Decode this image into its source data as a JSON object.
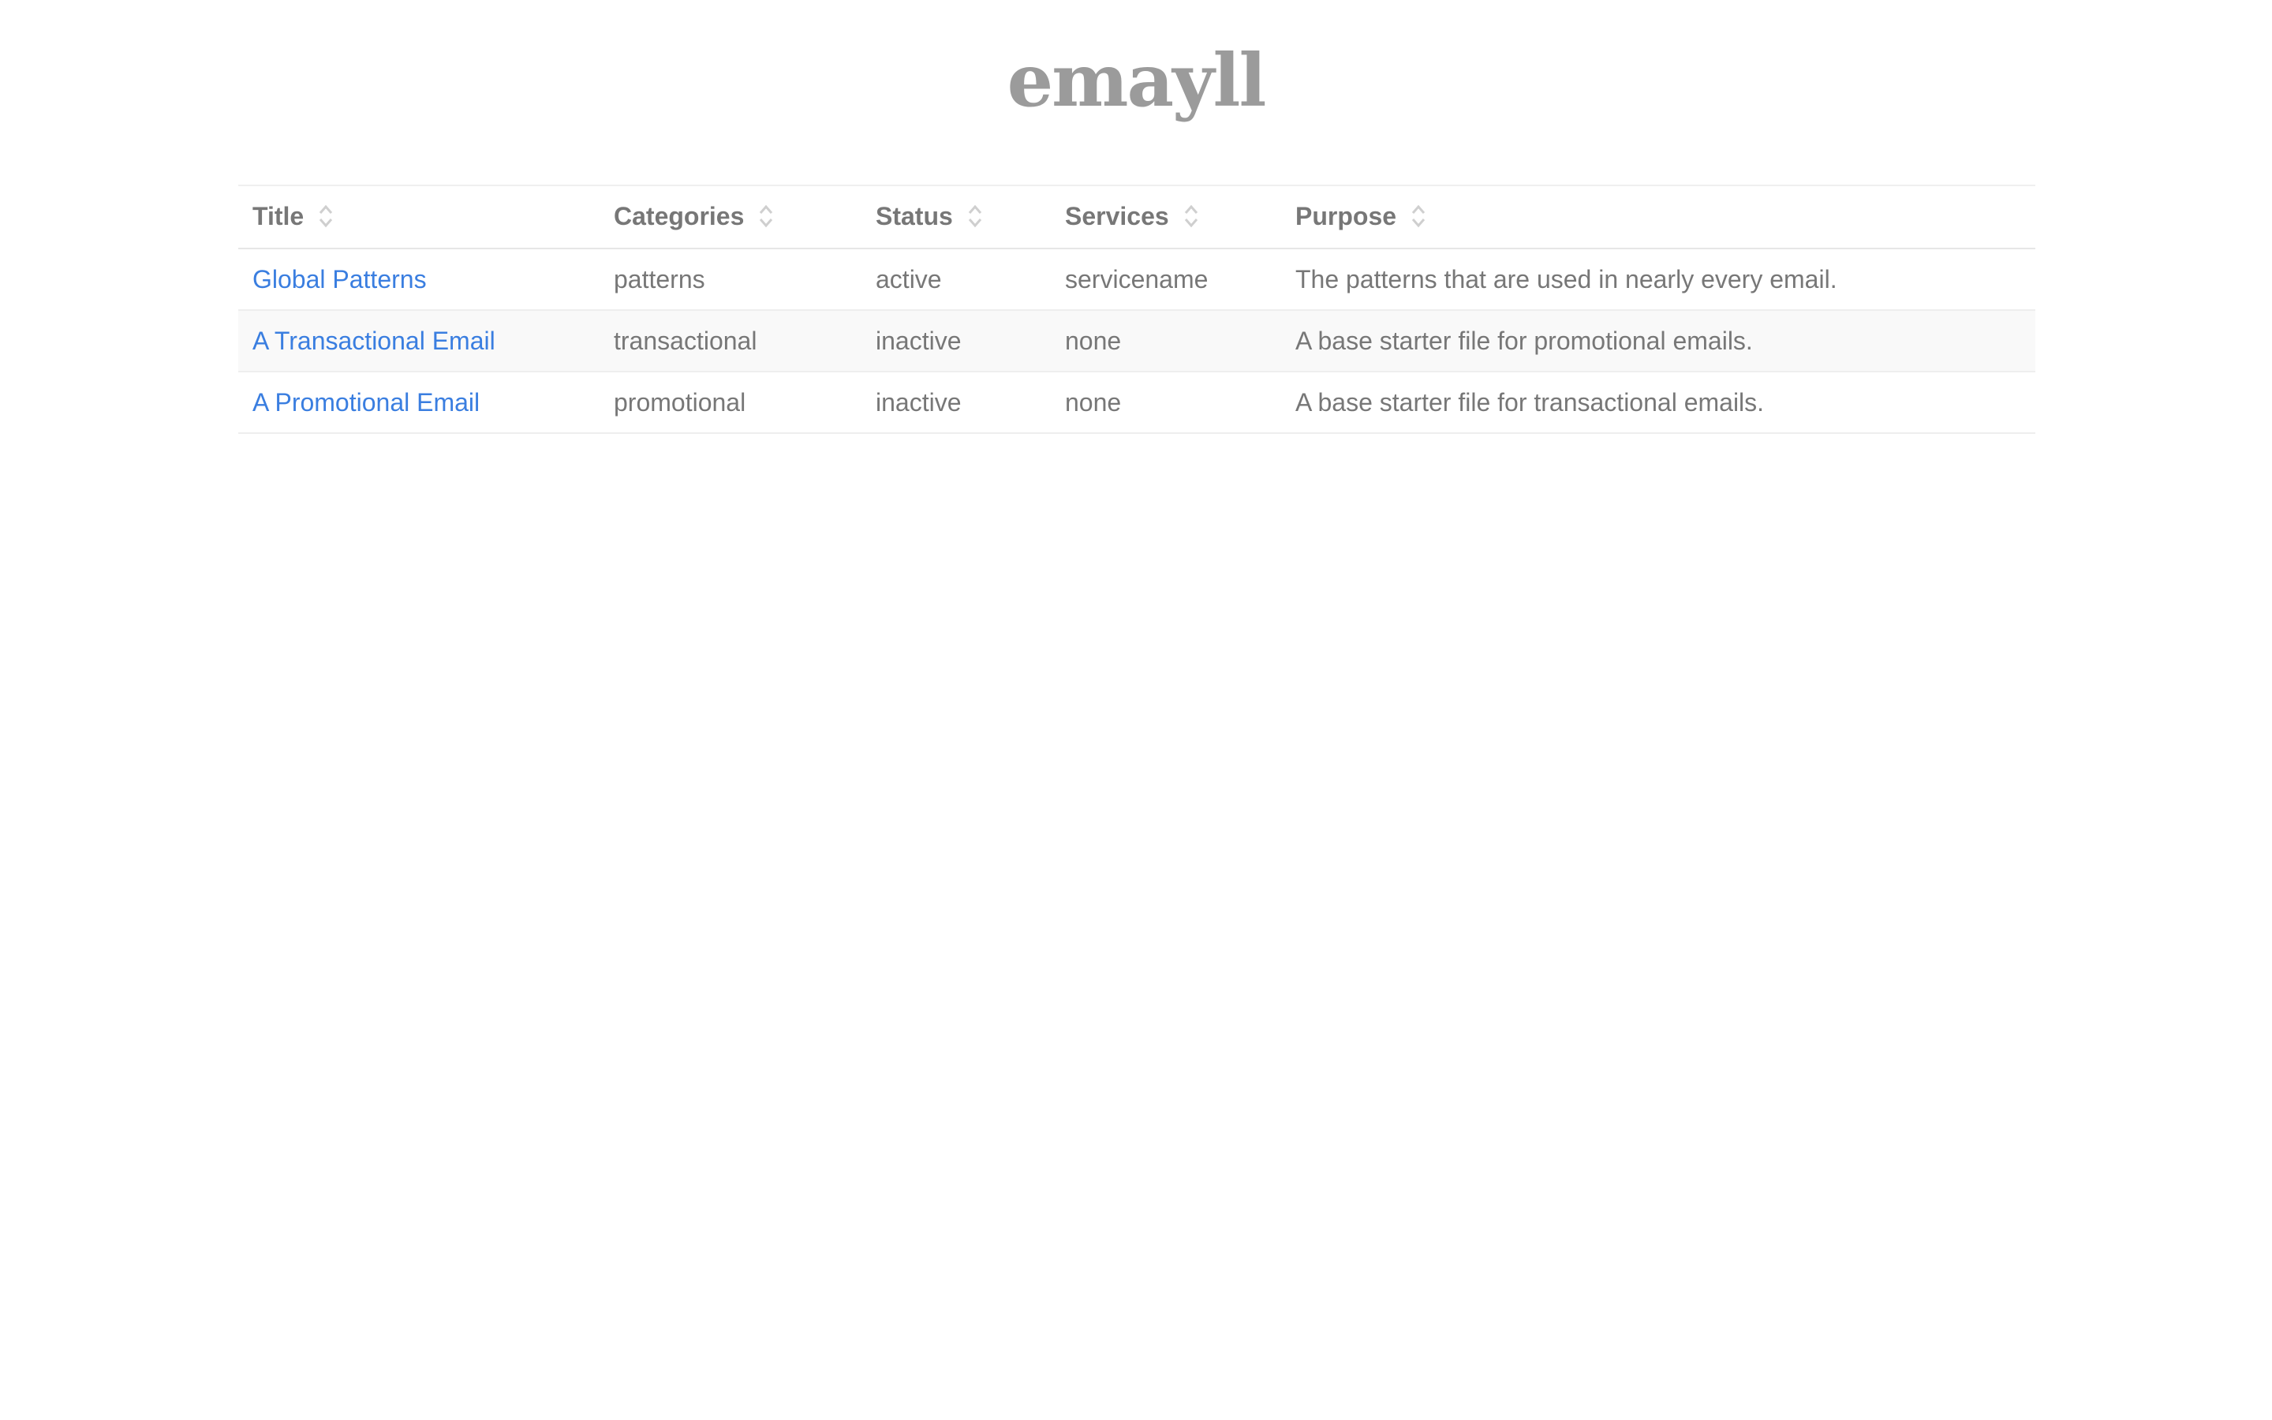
{
  "app": {
    "logo": "emayll"
  },
  "table": {
    "columns": [
      {
        "label": "Title"
      },
      {
        "label": "Categories"
      },
      {
        "label": "Status"
      },
      {
        "label": "Services"
      },
      {
        "label": "Purpose"
      }
    ],
    "rows": [
      {
        "title": "Global Patterns",
        "category": "patterns",
        "status": "active",
        "services": "servicename",
        "purpose": "The patterns that are used in nearly every email."
      },
      {
        "title": "A Transactional Email",
        "category": "transactional",
        "status": "inactive",
        "services": "none",
        "purpose": "A base starter file for promotional emails."
      },
      {
        "title": "A Promotional Email",
        "category": "promotional",
        "status": "inactive",
        "services": "none",
        "purpose": "A base starter file for transactional emails."
      }
    ]
  },
  "colors": {
    "link": "#3a7ee0",
    "active": "#6e9a4a",
    "inactive": "#d4b100",
    "text": "#777777",
    "logo": "#9b9b9b"
  },
  "icons": {
    "sort": "sort-updown-icon"
  }
}
